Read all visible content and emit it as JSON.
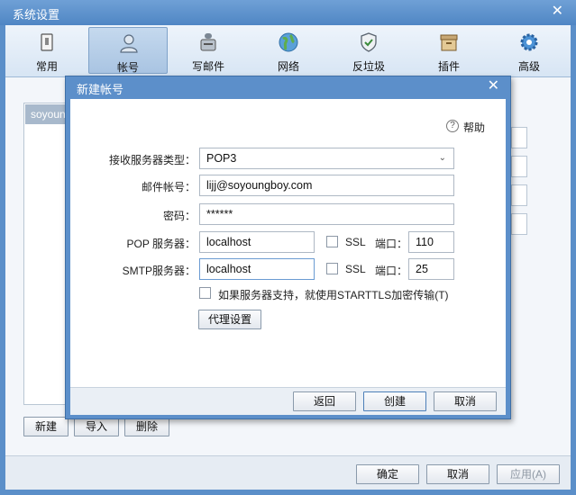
{
  "window": {
    "title": "系统设置",
    "close_symbol": "✕"
  },
  "toolbar": {
    "items": [
      {
        "label": "常用",
        "icon": "general-icon"
      },
      {
        "label": "帐号",
        "icon": "account-icon",
        "selected": true
      },
      {
        "label": "写邮件",
        "icon": "compose-icon"
      },
      {
        "label": "网络",
        "icon": "network-icon"
      },
      {
        "label": "反垃圾",
        "icon": "antispam-icon"
      },
      {
        "label": "插件",
        "icon": "plugin-icon"
      },
      {
        "label": "高级",
        "icon": "advanced-icon"
      }
    ]
  },
  "accounts": {
    "selected_item": "soyoun"
  },
  "account_buttons": {
    "new": "新建",
    "import": "导入",
    "delete": "删除"
  },
  "footer": {
    "ok": "确定",
    "cancel": "取消",
    "apply": "应用(A)"
  },
  "dialog": {
    "title": "新建帐号",
    "close_symbol": "✕",
    "help": "帮助",
    "labels": {
      "server_type": "接收服务器类型：",
      "email": "邮件帐号：",
      "password": "密码：",
      "pop_server": "POP 服务器：",
      "smtp_server": "SMTP服务器：",
      "ssl": "SSL",
      "port": "端口：",
      "starttls": "如果服务器支持，就使用STARTTLS加密传输(T)"
    },
    "values": {
      "server_type": "POP3",
      "email": "lijj@soyoungboy.com",
      "password": "******",
      "pop_server": "localhost",
      "pop_port": "110",
      "smtp_server": "localhost",
      "smtp_port": "25"
    },
    "buttons": {
      "proxy": "代理设置",
      "back": "返回",
      "create": "创建",
      "cancel": "取消"
    }
  },
  "colors": {
    "title_bar": "#5b8fc9",
    "selected_tab": "#a9c4e2"
  }
}
